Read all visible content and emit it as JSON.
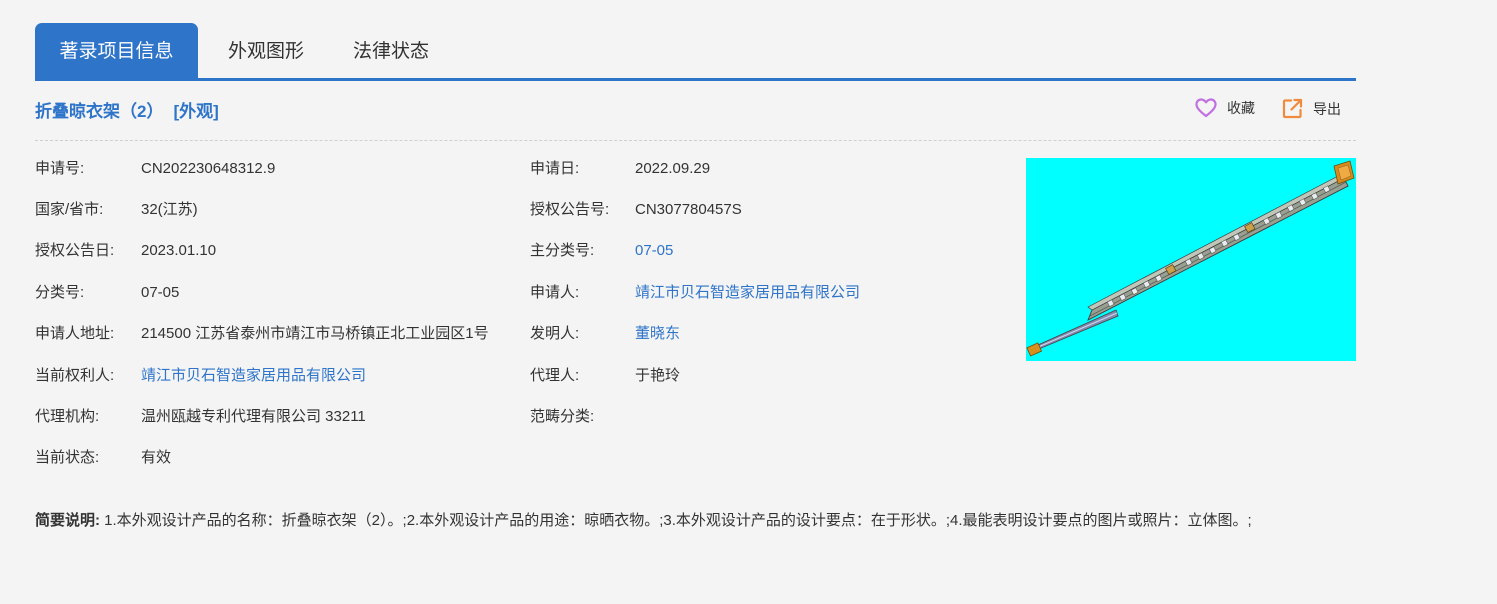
{
  "tabs": [
    {
      "label": "著录项目信息"
    },
    {
      "label": "外观图形"
    },
    {
      "label": "法律状态"
    }
  ],
  "header": {
    "title": "折叠晾衣架（2）",
    "type_tag": "[外观]",
    "favorite_label": "收藏",
    "export_label": "导出"
  },
  "fields": {
    "application_no": {
      "label": "申请号:",
      "value": "CN202230648312.9"
    },
    "application_date": {
      "label": "申请日:",
      "value": "2022.09.29"
    },
    "country": {
      "label": "国家/省市:",
      "value": "32(江苏)"
    },
    "grant_pub_no": {
      "label": "授权公告号:",
      "value": "CN307780457S"
    },
    "grant_pub_date": {
      "label": "授权公告日:",
      "value": "2023.01.10"
    },
    "main_class": {
      "label": "主分类号:",
      "value": "07-05"
    },
    "class_no": {
      "label": "分类号:",
      "value": "07-05"
    },
    "applicant": {
      "label": "申请人:",
      "value": "靖江市贝石智造家居用品有限公司"
    },
    "applicant_address": {
      "label": "申请人地址:",
      "value": "214500 江苏省泰州市靖江市马桥镇正北工业园区1号"
    },
    "inventor": {
      "label": "发明人:",
      "value": "董晓东"
    },
    "current_owner": {
      "label": "当前权利人:",
      "value": "靖江市贝石智造家居用品有限公司"
    },
    "agent": {
      "label": "代理人:",
      "value": "于艳玲"
    },
    "agency": {
      "label": "代理机构:",
      "value": "温州瓯越专利代理有限公司 33211"
    },
    "category": {
      "label": "范畴分类:",
      "value": ""
    },
    "status": {
      "label": "当前状态:",
      "value": "有效"
    }
  },
  "description": {
    "label": "简要说明:",
    "text": " 1.本外观设计产品的名称：折叠晾衣架（2）。;2.本外观设计产品的用途：晾晒衣物。;3.本外观设计产品的设计要点：在于形状。;4.最能表明设计要点的图片或照片：立体图。;"
  },
  "colors": {
    "accent": "#2e74c9",
    "image_background": "#00ffff",
    "favorite_icon": "#c070e0",
    "export_icon": "#f08a3c"
  },
  "icons": {
    "favorite": "heart-icon",
    "export": "export-icon"
  }
}
